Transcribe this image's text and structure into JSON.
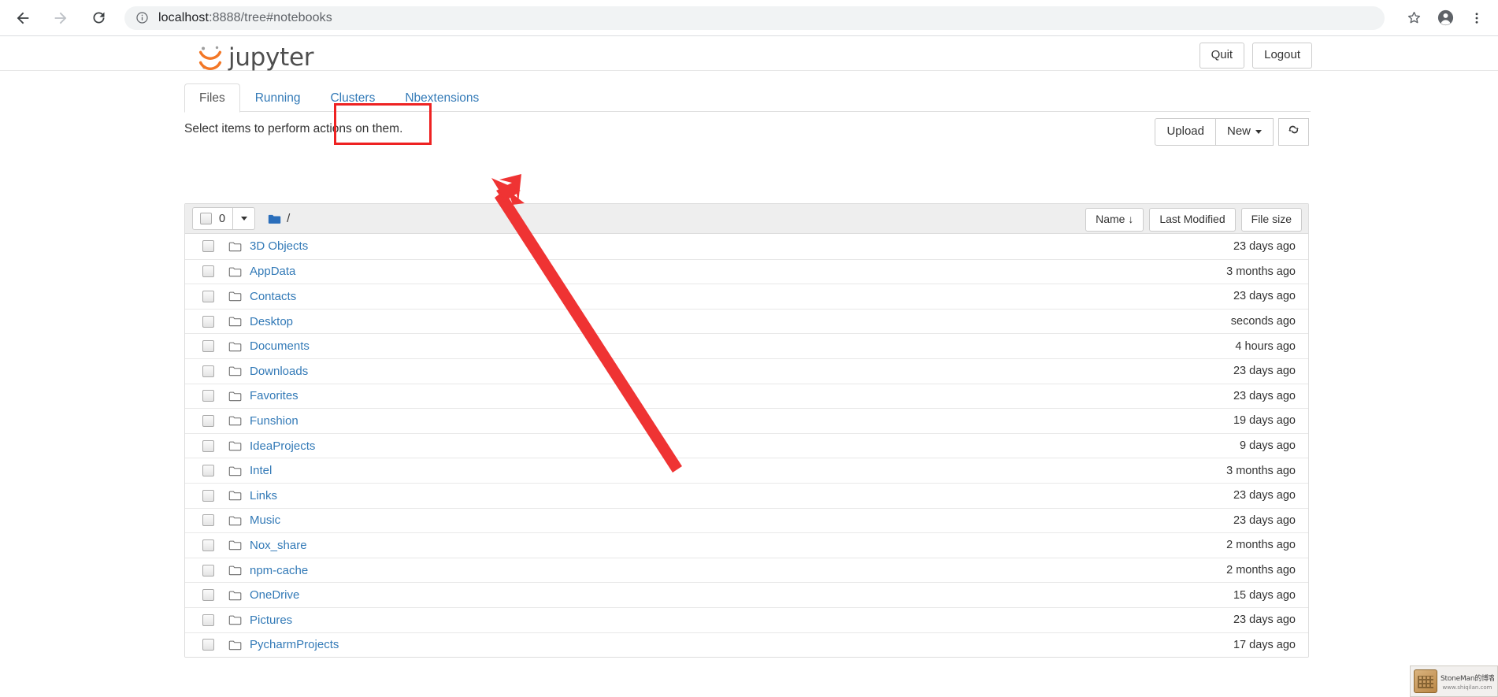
{
  "browser": {
    "back_label": "Back",
    "forward_label": "Forward",
    "reload_label": "Reload",
    "site_info_label": "Site information",
    "url_host": "localhost",
    "url_rest": ":8888/tree#notebooks",
    "bookmark_label": "Bookmark this page",
    "profile_label": "Profile",
    "menu_label": "Customize and control"
  },
  "jupyter": {
    "logo_text": "jupyter",
    "quit_label": "Quit",
    "logout_label": "Logout",
    "tabs": [
      {
        "label": "Files",
        "active": true
      },
      {
        "label": "Running",
        "active": false
      },
      {
        "label": "Clusters",
        "active": false
      },
      {
        "label": "Nbextensions",
        "active": false
      }
    ],
    "select_hint": "Select items to perform actions on them.",
    "upload_label": "Upload",
    "new_label": "New",
    "refresh_label": "Refresh",
    "selected_count": "0",
    "breadcrumb_path": "/",
    "sort_name": "Name",
    "sort_name_arrow": "↓",
    "sort_last_modified": "Last Modified",
    "sort_file_size": "File size",
    "accent_color": "#337ab7",
    "highlight_color": "#ee2222"
  },
  "files": [
    {
      "name": "3D Objects",
      "modified": "23 days ago"
    },
    {
      "name": "AppData",
      "modified": "3 months ago"
    },
    {
      "name": "Contacts",
      "modified": "23 days ago"
    },
    {
      "name": "Desktop",
      "modified": "seconds ago"
    },
    {
      "name": "Documents",
      "modified": "4 hours ago"
    },
    {
      "name": "Downloads",
      "modified": "23 days ago"
    },
    {
      "name": "Favorites",
      "modified": "23 days ago"
    },
    {
      "name": "Funshion",
      "modified": "19 days ago"
    },
    {
      "name": "IdeaProjects",
      "modified": "9 days ago"
    },
    {
      "name": "Intel",
      "modified": "3 months ago"
    },
    {
      "name": "Links",
      "modified": "23 days ago"
    },
    {
      "name": "Music",
      "modified": "23 days ago"
    },
    {
      "name": "Nox_share",
      "modified": "2 months ago"
    },
    {
      "name": "npm-cache",
      "modified": "2 months ago"
    },
    {
      "name": "OneDrive",
      "modified": "15 days ago"
    },
    {
      "name": "Pictures",
      "modified": "23 days ago"
    },
    {
      "name": "PycharmProjects",
      "modified": "17 days ago"
    }
  ],
  "watermark": {
    "title": "StoneMan的博客随笔",
    "url": "www.shiqilan.com"
  }
}
